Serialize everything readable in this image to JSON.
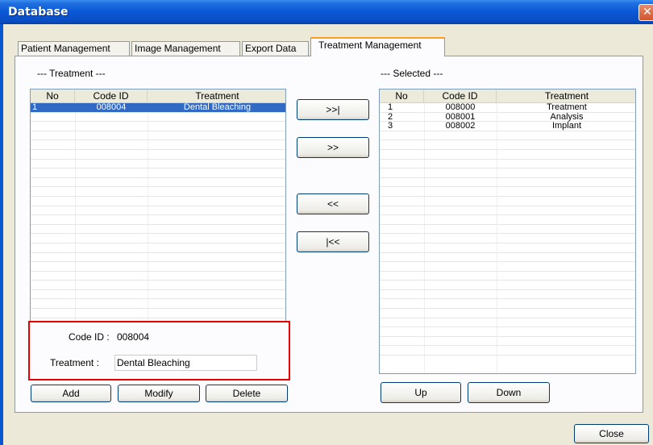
{
  "window": {
    "title": "Database",
    "close_glyph": "✕"
  },
  "tabs": [
    {
      "label": "Patient Management"
    },
    {
      "label": "Image Management"
    },
    {
      "label": "Export Data"
    },
    {
      "label": "Treatment Management"
    }
  ],
  "left_panel": {
    "group_label": "--- Treatment ---",
    "columns": [
      "No",
      "Code ID",
      "Treatment"
    ],
    "rows": [
      {
        "no": "1",
        "code": "008004",
        "treatment": "Dental Bleaching",
        "selected": true
      }
    ]
  },
  "right_panel": {
    "group_label": "--- Selected ---",
    "columns": [
      "No",
      "Code ID",
      "Treatment"
    ],
    "rows": [
      {
        "no": "1",
        "code": "008000",
        "treatment": "Treatment"
      },
      {
        "no": "2",
        "code": "008001",
        "treatment": "Analysis"
      },
      {
        "no": "3",
        "code": "008002",
        "treatment": "Implant"
      }
    ]
  },
  "transfer_buttons": {
    "add_all": ">>|",
    "add": ">>",
    "remove": "<<",
    "remove_all": "|<<"
  },
  "detail": {
    "code_label": "Code ID :",
    "code_value": "008004",
    "treatment_label": "Treatment :",
    "treatment_value": "Dental Bleaching"
  },
  "left_actions": {
    "add": "Add",
    "modify": "Modify",
    "delete": "Delete"
  },
  "right_actions": {
    "up": "Up",
    "down": "Down"
  },
  "footer": {
    "close": "Close"
  },
  "colors": {
    "selection": "#316ac5",
    "highlight_box": "#e60000",
    "tab_accent": "#ff9d1f"
  }
}
